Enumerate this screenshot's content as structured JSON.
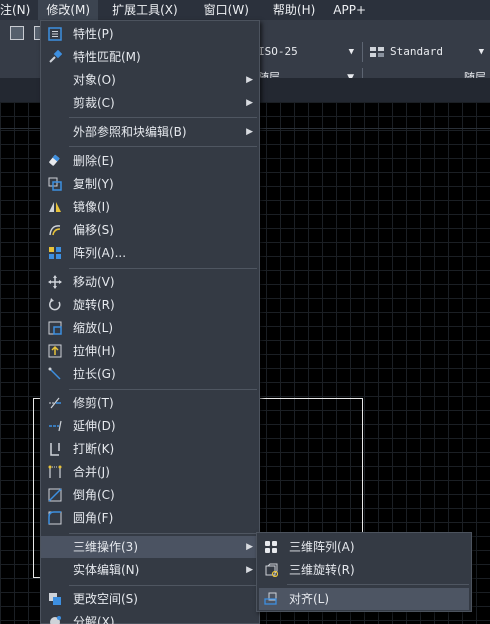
{
  "menubar": {
    "items": [
      "注(N)",
      "修改(M)",
      "扩展工具(X)",
      "窗口(W)",
      "帮助(H)",
      "APP+"
    ]
  },
  "toolbar": {
    "dimstyle": "ISO-25",
    "textstyle": "Standard",
    "layer_color": "随层",
    "layer_linetype": "随层"
  },
  "menu": {
    "items": [
      {
        "label": "特性(P)",
        "icon": "properties-icon"
      },
      {
        "label": "特性匹配(M)",
        "icon": "match-properties-icon"
      },
      {
        "label": "对象(O)",
        "submenu": true
      },
      {
        "label": "剪裁(C)",
        "submenu": true
      },
      {
        "label": "外部参照和块编辑(B)",
        "submenu": true
      },
      {
        "label": "删除(E)",
        "icon": "erase-icon"
      },
      {
        "label": "复制(Y)",
        "icon": "copy-icon"
      },
      {
        "label": "镜像(I)",
        "icon": "mirror-icon"
      },
      {
        "label": "偏移(S)",
        "icon": "offset-icon"
      },
      {
        "label": "阵列(A)...",
        "icon": "array-icon"
      },
      {
        "label": "移动(V)",
        "icon": "move-icon"
      },
      {
        "label": "旋转(R)",
        "icon": "rotate-icon"
      },
      {
        "label": "缩放(L)",
        "icon": "scale-icon"
      },
      {
        "label": "拉伸(H)",
        "icon": "stretch-icon"
      },
      {
        "label": "拉长(G)",
        "icon": "lengthen-icon"
      },
      {
        "label": "修剪(T)",
        "icon": "trim-icon"
      },
      {
        "label": "延伸(D)",
        "icon": "extend-icon"
      },
      {
        "label": "打断(K)",
        "icon": "break-icon"
      },
      {
        "label": "合并(J)",
        "icon": "join-icon"
      },
      {
        "label": "倒角(C)",
        "icon": "chamfer-icon"
      },
      {
        "label": "圆角(F)",
        "icon": "fillet-icon"
      },
      {
        "label": "三维操作(3)",
        "submenu": true,
        "highlighted": true
      },
      {
        "label": "实体编辑(N)",
        "submenu": true
      },
      {
        "label": "更改空间(S)",
        "icon": "change-space-icon"
      },
      {
        "label": "分解(X)",
        "icon": "explode-icon"
      }
    ]
  },
  "submenu": {
    "items": [
      {
        "label": "三维阵列(A)",
        "icon": "3d-array-icon"
      },
      {
        "label": "三维旋转(R)",
        "icon": "3d-rotate-icon"
      },
      {
        "label": "对齐(L)",
        "icon": "align-icon",
        "highlighted": true
      }
    ]
  },
  "colors": {
    "menu_bg": "#343a44",
    "highlight": "#4b5362",
    "icon_blue": "#3d8fe0",
    "icon_yellow": "#e8c33a",
    "canvas_bg": "#000000"
  }
}
